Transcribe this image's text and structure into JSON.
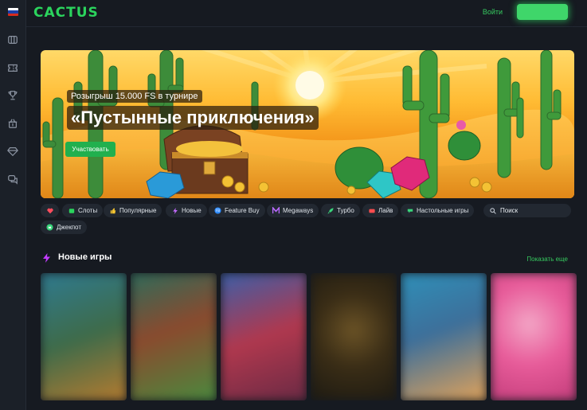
{
  "app": {
    "logo_text": "CACTUS",
    "brand_color": "#2bd45d"
  },
  "sidebar": {
    "flag": "russia-flag",
    "items": [
      {
        "icon": "slots-icon"
      },
      {
        "icon": "ticket-icon"
      },
      {
        "icon": "trophy-icon"
      },
      {
        "icon": "gift-basket-icon"
      },
      {
        "icon": "diamond-icon"
      },
      {
        "icon": "chat-icon"
      }
    ]
  },
  "header": {
    "login_label": "Войти",
    "register_label": ""
  },
  "banner": {
    "subtitle": "Розыгрыш 15.000 FS в турнире",
    "title": "«Пустынные приключения»",
    "cta_label": "Участвовать"
  },
  "filters": {
    "favorites_icon": "heart-icon",
    "chips": [
      {
        "label": "Слоты",
        "icon": "slots-icon",
        "color": "#2bd45d"
      },
      {
        "label": "Популярные",
        "icon": "thumbs-up-icon",
        "color": "#f4c430"
      },
      {
        "label": "Новые",
        "icon": "lightning-icon",
        "color": "#c56bff"
      },
      {
        "label": "Feature Buy",
        "icon": "feature-buy-icon",
        "color": "#2f8cff"
      },
      {
        "label": "Megaways",
        "icon": "megaways-icon",
        "color": "#b96bff"
      },
      {
        "label": "Турбо",
        "icon": "rocket-icon",
        "color": "#3ad47b"
      },
      {
        "label": "Лайв",
        "icon": "live-icon",
        "color": "#ff4d4f"
      },
      {
        "label": "Настольные игры",
        "icon": "table-games-icon",
        "color": "#3ad47b"
      },
      {
        "label": "Джекпот",
        "icon": "jackpot-icon",
        "color": "#3ad47b"
      }
    ],
    "search_placeholder": "Поиск"
  },
  "new_games": {
    "title": "Новые игры",
    "show_more": "Показать еще",
    "games": [
      {
        "thumb": "blurred-game-thumbnail",
        "colors": [
          "#3e6b4a",
          "#2f7a8f"
        ]
      },
      {
        "thumb": "blurred-game-thumbnail",
        "colors": [
          "#2f6b5a",
          "#4a8a3e"
        ]
      },
      {
        "thumb": "blurred-game-thumbnail",
        "colors": [
          "#b0384e",
          "#3c5fa8"
        ]
      },
      {
        "thumb": "blurred-game-thumbnail",
        "colors": [
          "#1d1a12",
          "#6b5326"
        ]
      },
      {
        "thumb": "blurred-game-thumbnail",
        "colors": [
          "#2f8fb8",
          "#e0a25a"
        ]
      },
      {
        "thumb": "blurred-game-thumbnail",
        "colors": [
          "#e85c9a",
          "#f3a6c6"
        ]
      }
    ]
  }
}
